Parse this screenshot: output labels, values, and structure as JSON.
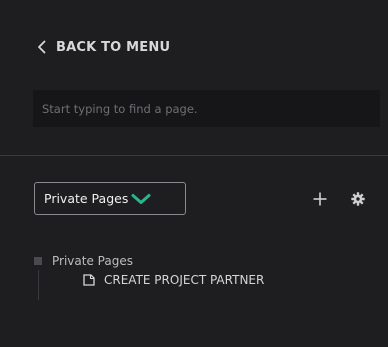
{
  "nav": {
    "back_label": "BACK TO MENU",
    "back_icon": "chevron-left-icon"
  },
  "search": {
    "placeholder": "Start typing to find a page."
  },
  "toolbar": {
    "selected_view": "Private Pages",
    "caret_icon": "chevron-down-icon",
    "caret_color": "#2bb58f",
    "add_icon": "plus-icon",
    "settings_icon": "gear-icon"
  },
  "tree": {
    "root_label": "Private Pages",
    "children": [
      {
        "label": "CREATE PROJECT PARTNER",
        "icon": "page-icon"
      }
    ]
  }
}
